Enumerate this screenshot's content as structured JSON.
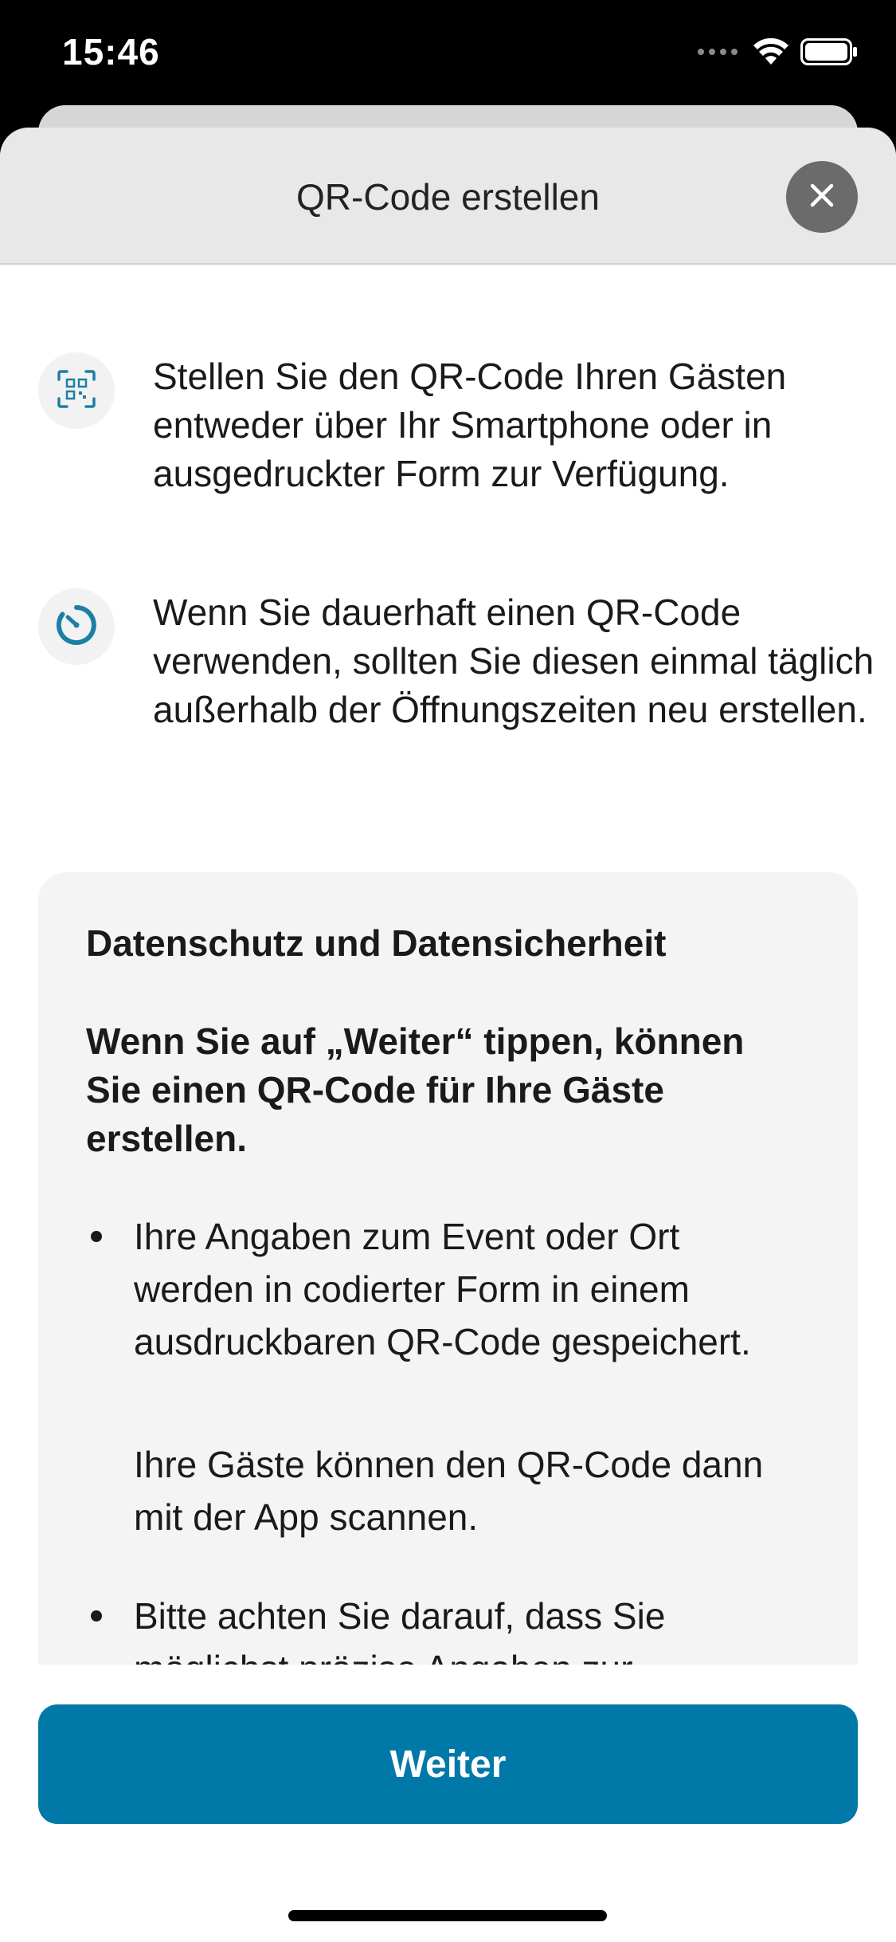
{
  "status_bar": {
    "time": "15:46"
  },
  "sheet": {
    "title": "QR-Code erstellen"
  },
  "info_items": [
    {
      "icon": "qr-code-icon",
      "text": "Stellen Sie den QR-Code Ihren Gästen entweder über Ihr Smartphone oder in ausgedruckter Form zur Verfügung."
    },
    {
      "icon": "timer-icon",
      "text": "Wenn Sie dauerhaft einen QR-Code verwenden, sollten Sie diesen einmal täglich außerhalb der Öffnungszeiten neu erstellen."
    }
  ],
  "privacy": {
    "title": "Datenschutz und Datensicherheit",
    "intro": "Wenn Sie auf „Weiter“ tippen, können Sie einen QR-Code für Ihre Gäste erstellen.",
    "bullets": [
      {
        "text": "Ihre Angaben zum Event oder Ort werden in codierter Form in einem ausdruckbaren QR-Code gespeichert.",
        "sub": "Ihre Gäste können den QR-Code dann mit der App scannen."
      },
      {
        "text": "Bitte achten Sie darauf, dass Sie möglichst präzise Angaben zur"
      }
    ]
  },
  "actions": {
    "continue_label": "Weiter"
  },
  "colors": {
    "primary": "#0179a8",
    "icon_accent": "#1d7fa6",
    "close_button": "#6b6b6b",
    "card_background": "#f4f4f4"
  }
}
